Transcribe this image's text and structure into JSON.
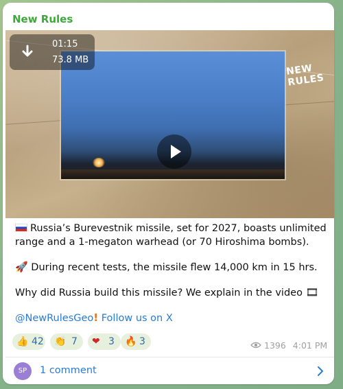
{
  "channel": {
    "name": "New Rules"
  },
  "video": {
    "duration": "01:15",
    "size": "73.8 MB",
    "watermark": "NEW RULES"
  },
  "post": {
    "line1": "Russia’s Burevestnik missile, set for 2027, boasts unlimited range and a 1-megaton warhead (or 70 Hiroshima bombs).",
    "line2": "During recent tests, the missile flew 14,000 km in 15 hrs.",
    "line3": "Why did Russia build this missile? We explain in the video",
    "handle": "@NewRulesGeo",
    "follow": "Follow us on X"
  },
  "reactions": [
    {
      "emoji": "👍",
      "count": "42"
    },
    {
      "emoji": "👏",
      "count": "7"
    },
    {
      "emoji": "❤",
      "count": "3"
    },
    {
      "emoji": "🔥",
      "count": "3"
    }
  ],
  "meta": {
    "views": "1396",
    "time": "4:01 PM"
  },
  "comments": {
    "avatar_initials": "SP",
    "label": "1 comment"
  },
  "icons": {
    "download": "download-arrow-icon",
    "play": "play-icon",
    "eye": "eye-icon",
    "chevron": "chevron-right-icon"
  },
  "colors": {
    "channel": "#3fa73c",
    "link": "#2a7bd6",
    "reaction_bg": "#e6f0dc"
  }
}
